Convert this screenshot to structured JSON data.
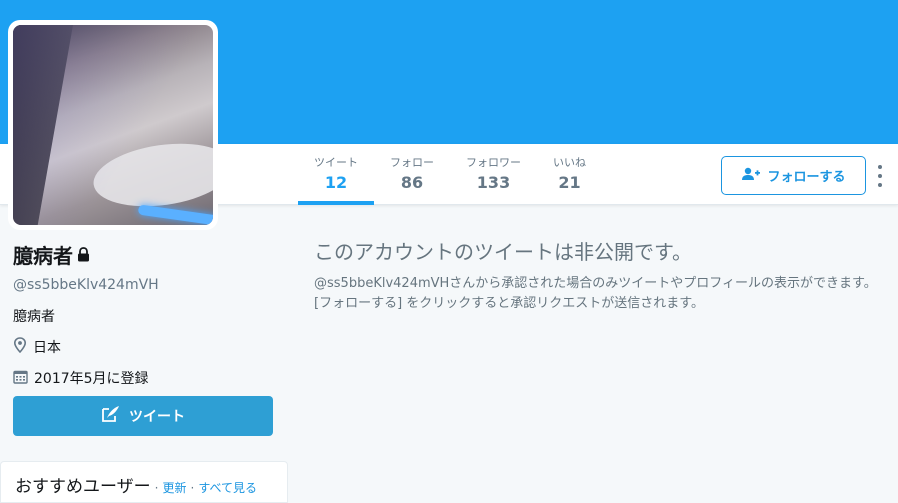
{
  "profile": {
    "name": "臆病者",
    "handle": "@ss5bbeKlv424mVH",
    "bio": "臆病者",
    "location": "日本",
    "joined": "2017年5月に登録"
  },
  "stats": [
    {
      "label": "ツイート",
      "value": "12"
    },
    {
      "label": "フォロー",
      "value": "86"
    },
    {
      "label": "フォロワー",
      "value": "133"
    },
    {
      "label": "いいね",
      "value": "21"
    }
  ],
  "follow_button": {
    "label": "フォローする"
  },
  "tweet_button": {
    "label": "ツイート"
  },
  "suggestions": {
    "title": "おすすめユーザー",
    "refresh": "更新",
    "view_all": "すべて見る"
  },
  "protected": {
    "title": "このアカウントのツイートは非公開です。",
    "description": "@ss5bbeKlv424mVHさんから承認された場合のみツイートやプロフィールの表示ができます。[フォローする] をクリックすると承認リクエストが送信されます。"
  },
  "colors": {
    "brand": "#1da1f2",
    "tweet_button": "#2e9fd4",
    "muted_text": "#657786"
  },
  "icons": [
    "lock-icon",
    "location-pin-icon",
    "calendar-icon",
    "follow-person-icon",
    "compose-quill-icon",
    "more-vertical-icon"
  ]
}
